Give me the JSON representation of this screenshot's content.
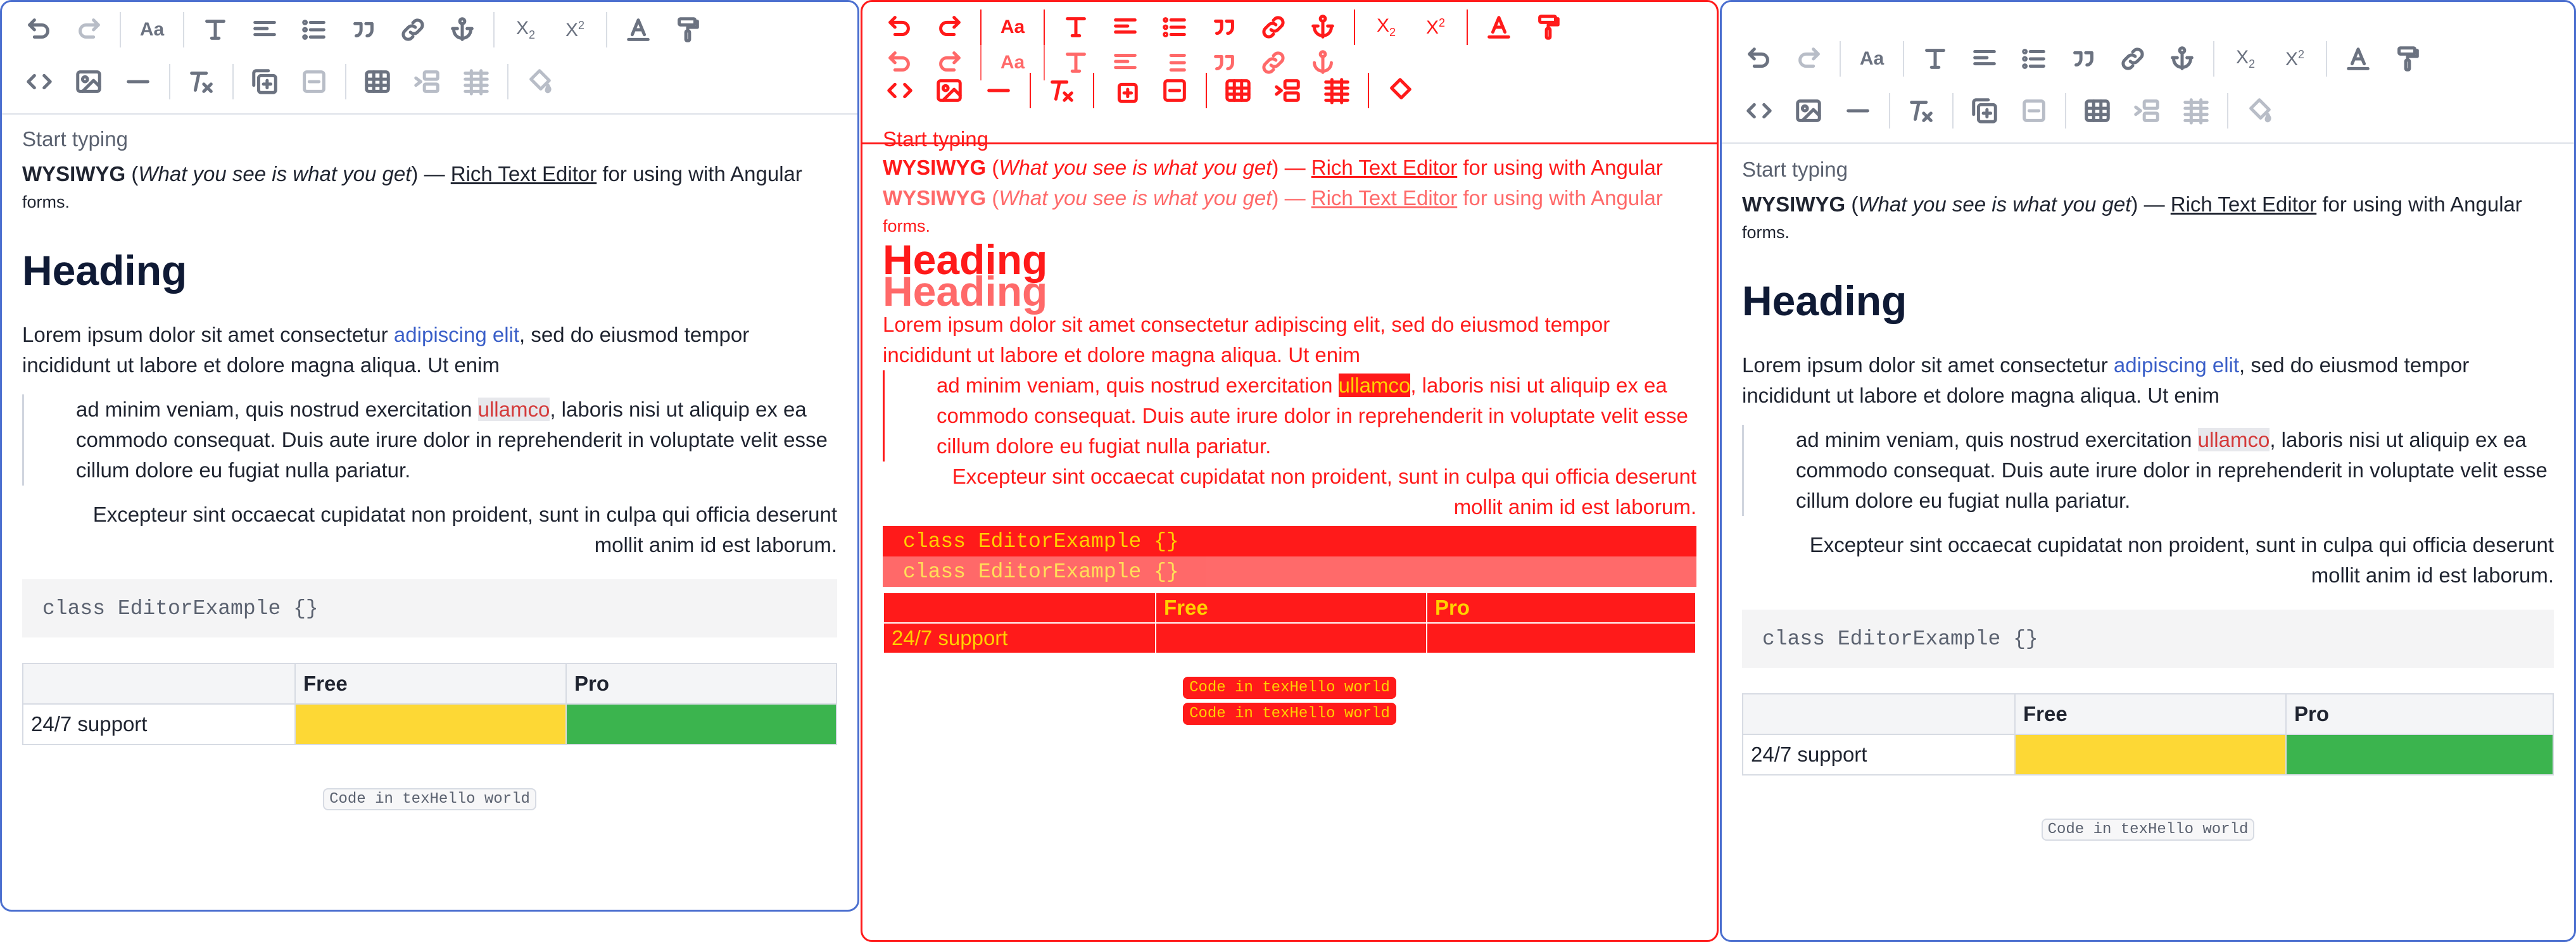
{
  "toolbar": {
    "row1": [
      {
        "icon": "undo-icon",
        "glyph": "↶",
        "enabled": true
      },
      {
        "icon": "redo-icon",
        "glyph": "↷",
        "enabled": false
      },
      {
        "icon": "font-size-icon",
        "glyph": "Aa",
        "enabled": true
      },
      {
        "icon": "text-format-icon",
        "glyph": "T",
        "enabled": true
      },
      {
        "icon": "align-left-icon",
        "glyph": "≡",
        "enabled": true
      },
      {
        "icon": "bullet-list-icon",
        "glyph": "☰",
        "enabled": true
      },
      {
        "icon": "blockquote-icon",
        "glyph": "❞",
        "enabled": true
      },
      {
        "icon": "link-icon",
        "glyph": "🔗",
        "enabled": true
      },
      {
        "icon": "anchor-icon",
        "glyph": "⚓",
        "enabled": true
      },
      {
        "icon": "subscript-icon",
        "glyph": "X₂",
        "enabled": true
      },
      {
        "icon": "superscript-icon",
        "glyph": "X²",
        "enabled": true
      },
      {
        "icon": "text-color-icon",
        "glyph": "A",
        "enabled": true
      },
      {
        "icon": "paint-roller-icon",
        "glyph": "🖌",
        "enabled": true
      }
    ],
    "row2": [
      {
        "icon": "code-icon",
        "glyph": "<>",
        "enabled": true
      },
      {
        "icon": "image-icon",
        "glyph": "▣",
        "enabled": true
      },
      {
        "icon": "horizontal-rule-icon",
        "glyph": "—",
        "enabled": true
      },
      {
        "icon": "clear-format-icon",
        "glyph": "Tx",
        "enabled": true
      },
      {
        "icon": "add-block-icon",
        "glyph": "⊞",
        "enabled": true
      },
      {
        "icon": "remove-block-icon",
        "glyph": "⊟",
        "enabled": true
      },
      {
        "icon": "table-icon",
        "glyph": "▦",
        "enabled": true
      },
      {
        "icon": "table-insert-row-icon",
        "glyph": "⇥",
        "enabled": false
      },
      {
        "icon": "table-delete-icon",
        "glyph": "⋕",
        "enabled": false
      },
      {
        "icon": "fill-color-icon",
        "glyph": "◇",
        "enabled": false
      }
    ]
  },
  "editor": {
    "placeholder": "Start typing",
    "intro_bold": "WYSIWYG",
    "intro_open": " (",
    "intro_italic": "What you see is what you get",
    "intro_close": ") — ",
    "intro_link": "Rich Text Editor",
    "intro_rest": " for using with Angular",
    "intro_wrap": "forms.",
    "heading": "Heading",
    "para_start": "Lorem ipsum dolor sit amet consectetur ",
    "para_link": "adipiscing elit",
    "para_end": ", sed do eiusmod tempor incididunt ut labore et dolore magna aliqua. Ut enim",
    "quote_start": "ad minim veniam, quis nostrud exercitation ",
    "quote_mark": "ullamco",
    "quote_end": ", laboris nisi ut aliquip ex ea commodo consequat. Duis aute irure dolor in reprehenderit in voluptate velit esse cillum dolore eu fugiat nulla pariatur.",
    "right_text": "Excepteur sint occaecat cupidatat non proident, sunt in culpa qui officia deserunt mollit anim id est laborum.",
    "code": "class EditorExample {}",
    "table": {
      "headers": [
        "",
        "Free",
        "Pro"
      ],
      "row_label": "24/7 support"
    },
    "inline_code": "Code in texHello world"
  },
  "colors": {
    "border": "#4b6fcf",
    "debug": "#ff1a1a",
    "free": "#fdd835",
    "pro": "#3bb44e"
  }
}
